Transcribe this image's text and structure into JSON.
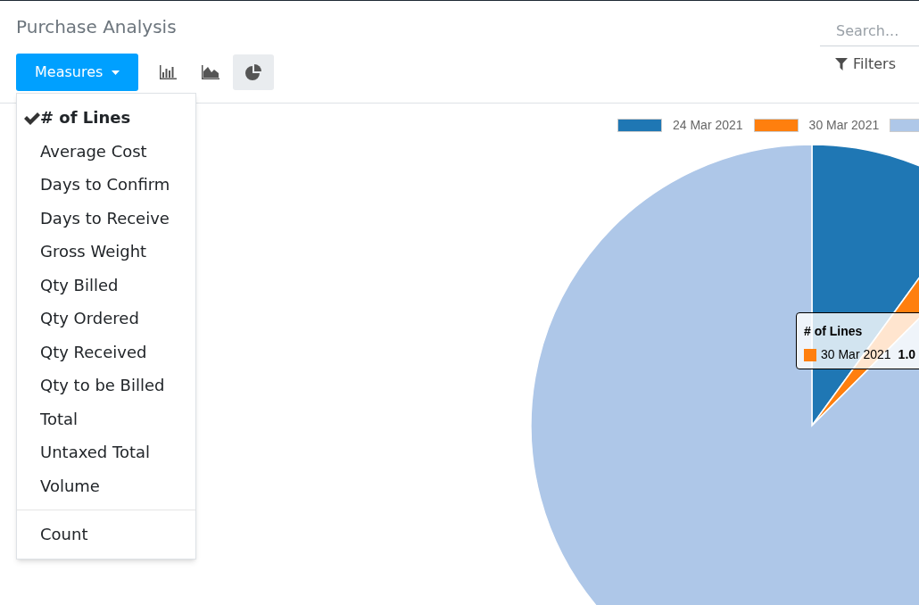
{
  "page": {
    "title": "Purchase Analysis"
  },
  "toolbar": {
    "measures_button": "Measures",
    "view_buttons": [
      {
        "kind": "bar",
        "selected": false
      },
      {
        "kind": "line",
        "selected": false
      },
      {
        "kind": "pie",
        "selected": true
      }
    ]
  },
  "search": {
    "placeholder": "Search..."
  },
  "filters_button": "Filters",
  "measures_menu": {
    "items": [
      {
        "label": "# of Lines",
        "checked": true
      },
      {
        "label": "Average Cost",
        "checked": false
      },
      {
        "label": "Days to Confirm",
        "checked": false
      },
      {
        "label": "Days to Receive",
        "checked": false
      },
      {
        "label": "Gross Weight",
        "checked": false
      },
      {
        "label": "Qty Billed",
        "checked": false
      },
      {
        "label": "Qty Ordered",
        "checked": false
      },
      {
        "label": "Qty Received",
        "checked": false
      },
      {
        "label": "Qty to be Billed",
        "checked": false
      },
      {
        "label": "Total",
        "checked": false
      },
      {
        "label": "Untaxed Total",
        "checked": false
      },
      {
        "label": "Volume",
        "checked": false
      }
    ],
    "extra_items": [
      {
        "label": "Count",
        "checked": false
      }
    ]
  },
  "legend": [
    {
      "label": "24 Mar 2021",
      "color": "#1f77b4"
    },
    {
      "label": "30 Mar 2021",
      "color": "#ff7f0e"
    },
    {
      "color": "#aec7e8"
    }
  ],
  "tooltip": {
    "title": "# of Lines",
    "label": "30 Mar 2021",
    "value": "1.0",
    "color": "#ff7f0e"
  }
}
